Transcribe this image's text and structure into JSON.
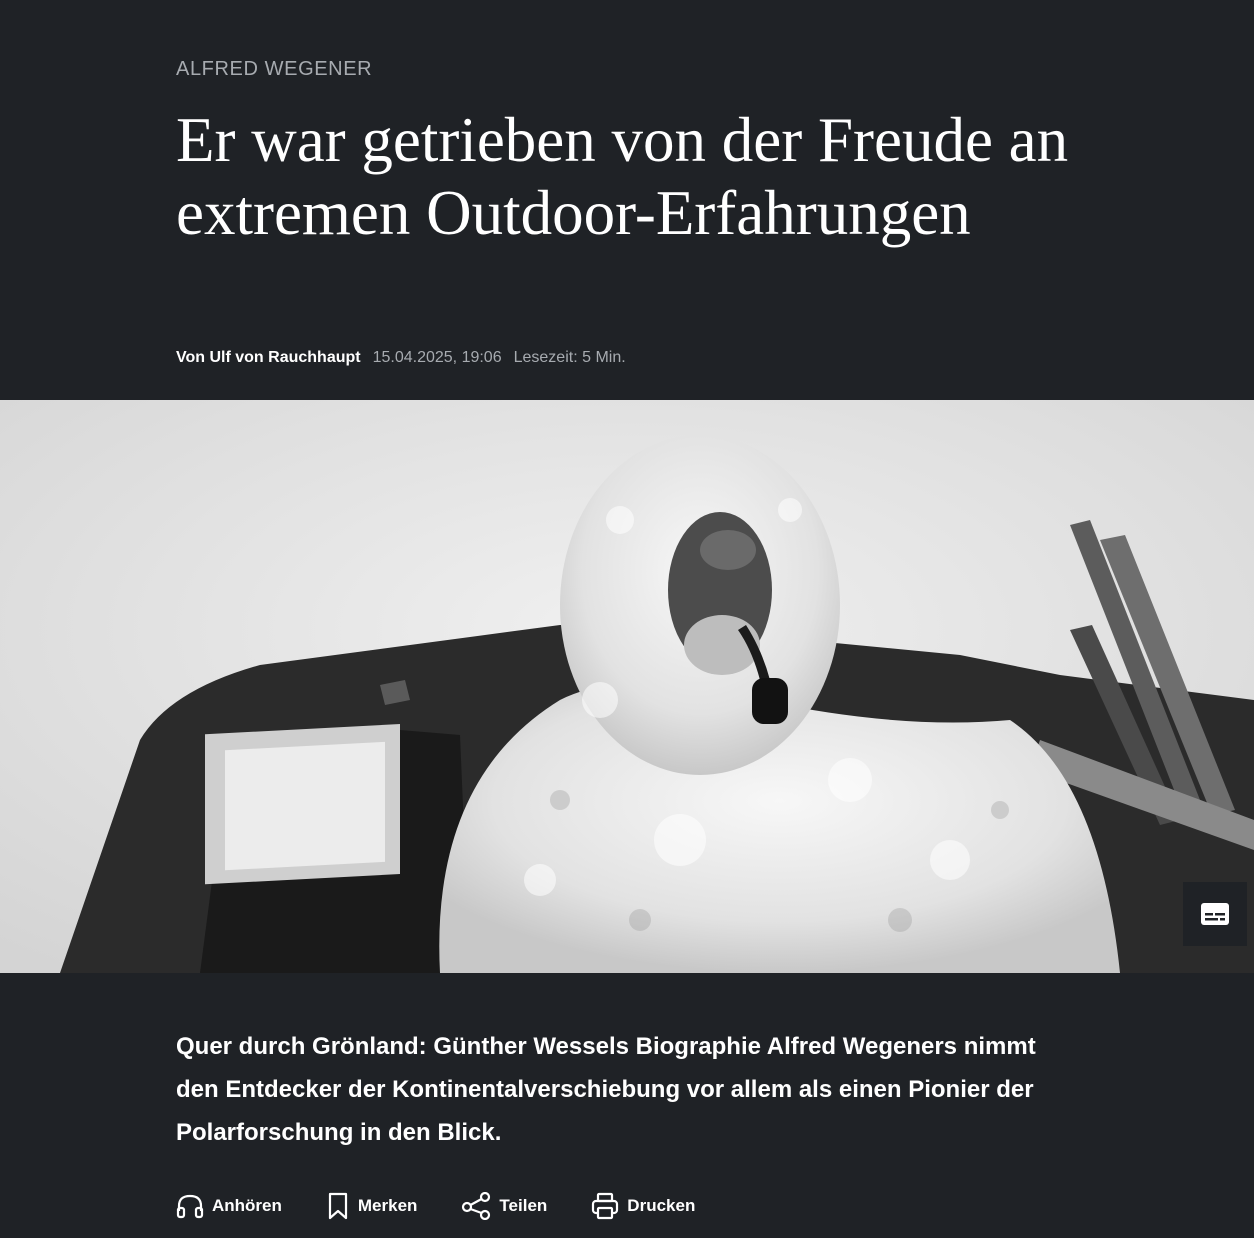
{
  "article": {
    "kicker": "ALFRED WEGENER",
    "headline": "Er war getrieben von der Freude an extremen Outdoor-Erfahrungen",
    "byline": {
      "author": "Von Ulf von Rauchhaupt",
      "date": "15.04.2025, 19:06",
      "reading_time": "Lesezeit: 5 Min."
    },
    "teaser": "Quer durch Grönland: Günther Wessels Biographie Alfred Wegeners nimmt den Entdecker der Kontinentalverschiebung vor allem als einen Pionier der Polarforschung in den Blick."
  },
  "hero_image": {
    "subject": "black-and-white photo of a man in fur hood smoking a pipe in front of a hut"
  },
  "actions": [
    {
      "label": "Anhören",
      "icon": "headphones-icon"
    },
    {
      "label": "Merken",
      "icon": "bookmark-icon"
    },
    {
      "label": "Teilen",
      "icon": "share-icon"
    },
    {
      "label": "Drucken",
      "icon": "printer-icon"
    }
  ],
  "caption_toggle": {
    "icon": "subtitles-icon"
  },
  "colors": {
    "background": "#1f2226",
    "text": "#ffffff",
    "muted": "#a7abb0"
  }
}
